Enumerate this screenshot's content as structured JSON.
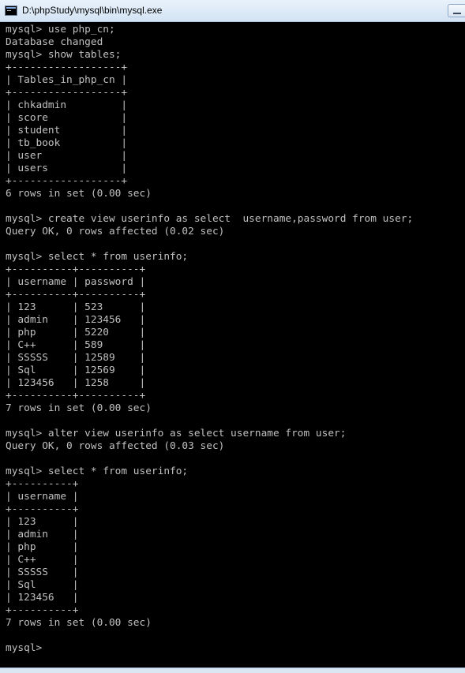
{
  "window": {
    "title": "D:\\phpStudy\\mysql\\bin\\mysql.exe",
    "icon": "console-window-icon"
  },
  "console": {
    "lines": [
      "mysql> use php_cn;",
      "Database changed",
      "mysql> show tables;",
      "+------------------+",
      "| Tables_in_php_cn |",
      "+------------------+",
      "| chkadmin         |",
      "| score            |",
      "| student          |",
      "| tb_book          |",
      "| user             |",
      "| users            |",
      "+------------------+",
      "6 rows in set (0.00 sec)",
      "",
      "mysql> create view userinfo as select  username,password from user;",
      "Query OK, 0 rows affected (0.02 sec)",
      "",
      "mysql> select * from userinfo;",
      "+----------+----------+",
      "| username | password |",
      "+----------+----------+",
      "| 123      | 523      |",
      "| admin    | 123456   |",
      "| php      | 5220     |",
      "| C++      | 589      |",
      "| SSSSS    | 12589    |",
      "| Sql      | 12569    |",
      "| 123456   | 1258     |",
      "+----------+----------+",
      "7 rows in set (0.00 sec)",
      "",
      "mysql> alter view userinfo as select username from user;",
      "Query OK, 0 rows affected (0.03 sec)",
      "",
      "mysql> select * from userinfo;",
      "+----------+",
      "| username |",
      "+----------+",
      "| 123      |",
      "| admin    |",
      "| php      |",
      "| C++      |",
      "| SSSSS    |",
      "| Sql      |",
      "| 123456   |",
      "+----------+",
      "7 rows in set (0.00 sec)",
      "",
      "mysql>"
    ]
  },
  "colors": {
    "console_background": "#000000",
    "console_text": "#c0c0c0",
    "titlebar": "#dbe7f5"
  }
}
